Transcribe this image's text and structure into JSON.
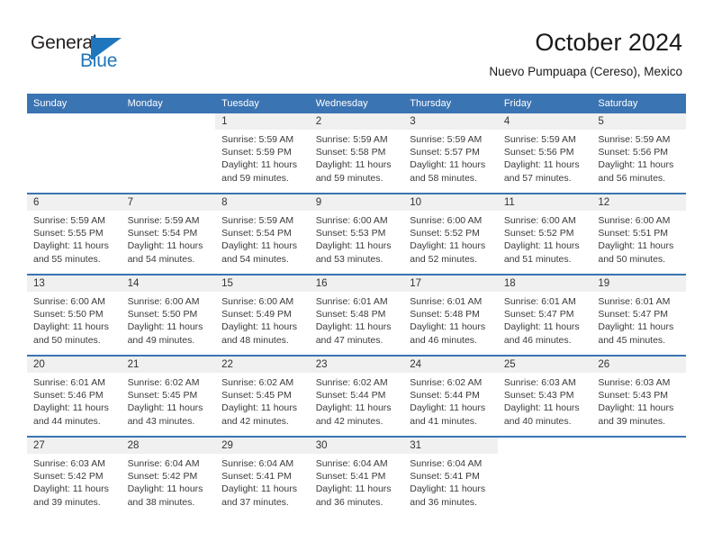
{
  "brand": {
    "name_part1": "General",
    "name_part2": "Blue",
    "logo_icon": "general-blue-triangle-logo",
    "accent_color": "#1f76bc"
  },
  "header": {
    "title": "October 2024",
    "location": "Nuevo Pumpuapa (Cereso), Mexico"
  },
  "theme": {
    "header_bg": "#3b74b3",
    "daynum_band_bg": "#f0f0f0",
    "separator_color": "#3b74b3",
    "text_color": "#3a3a3a"
  },
  "weekday_headers": [
    "Sunday",
    "Monday",
    "Tuesday",
    "Wednesday",
    "Thursday",
    "Friday",
    "Saturday"
  ],
  "weeks": [
    [
      {
        "day": "",
        "blank": true
      },
      {
        "day": "",
        "blank": true
      },
      {
        "day": "1",
        "sunrise": "Sunrise: 5:59 AM",
        "sunset": "Sunset: 5:59 PM",
        "daylight1": "Daylight: 11 hours",
        "daylight2": "and 59 minutes."
      },
      {
        "day": "2",
        "sunrise": "Sunrise: 5:59 AM",
        "sunset": "Sunset: 5:58 PM",
        "daylight1": "Daylight: 11 hours",
        "daylight2": "and 59 minutes."
      },
      {
        "day": "3",
        "sunrise": "Sunrise: 5:59 AM",
        "sunset": "Sunset: 5:57 PM",
        "daylight1": "Daylight: 11 hours",
        "daylight2": "and 58 minutes."
      },
      {
        "day": "4",
        "sunrise": "Sunrise: 5:59 AM",
        "sunset": "Sunset: 5:56 PM",
        "daylight1": "Daylight: 11 hours",
        "daylight2": "and 57 minutes."
      },
      {
        "day": "5",
        "sunrise": "Sunrise: 5:59 AM",
        "sunset": "Sunset: 5:56 PM",
        "daylight1": "Daylight: 11 hours",
        "daylight2": "and 56 minutes."
      }
    ],
    [
      {
        "day": "6",
        "sunrise": "Sunrise: 5:59 AM",
        "sunset": "Sunset: 5:55 PM",
        "daylight1": "Daylight: 11 hours",
        "daylight2": "and 55 minutes."
      },
      {
        "day": "7",
        "sunrise": "Sunrise: 5:59 AM",
        "sunset": "Sunset: 5:54 PM",
        "daylight1": "Daylight: 11 hours",
        "daylight2": "and 54 minutes."
      },
      {
        "day": "8",
        "sunrise": "Sunrise: 5:59 AM",
        "sunset": "Sunset: 5:54 PM",
        "daylight1": "Daylight: 11 hours",
        "daylight2": "and 54 minutes."
      },
      {
        "day": "9",
        "sunrise": "Sunrise: 6:00 AM",
        "sunset": "Sunset: 5:53 PM",
        "daylight1": "Daylight: 11 hours",
        "daylight2": "and 53 minutes."
      },
      {
        "day": "10",
        "sunrise": "Sunrise: 6:00 AM",
        "sunset": "Sunset: 5:52 PM",
        "daylight1": "Daylight: 11 hours",
        "daylight2": "and 52 minutes."
      },
      {
        "day": "11",
        "sunrise": "Sunrise: 6:00 AM",
        "sunset": "Sunset: 5:52 PM",
        "daylight1": "Daylight: 11 hours",
        "daylight2": "and 51 minutes."
      },
      {
        "day": "12",
        "sunrise": "Sunrise: 6:00 AM",
        "sunset": "Sunset: 5:51 PM",
        "daylight1": "Daylight: 11 hours",
        "daylight2": "and 50 minutes."
      }
    ],
    [
      {
        "day": "13",
        "sunrise": "Sunrise: 6:00 AM",
        "sunset": "Sunset: 5:50 PM",
        "daylight1": "Daylight: 11 hours",
        "daylight2": "and 50 minutes."
      },
      {
        "day": "14",
        "sunrise": "Sunrise: 6:00 AM",
        "sunset": "Sunset: 5:50 PM",
        "daylight1": "Daylight: 11 hours",
        "daylight2": "and 49 minutes."
      },
      {
        "day": "15",
        "sunrise": "Sunrise: 6:00 AM",
        "sunset": "Sunset: 5:49 PM",
        "daylight1": "Daylight: 11 hours",
        "daylight2": "and 48 minutes."
      },
      {
        "day": "16",
        "sunrise": "Sunrise: 6:01 AM",
        "sunset": "Sunset: 5:48 PM",
        "daylight1": "Daylight: 11 hours",
        "daylight2": "and 47 minutes."
      },
      {
        "day": "17",
        "sunrise": "Sunrise: 6:01 AM",
        "sunset": "Sunset: 5:48 PM",
        "daylight1": "Daylight: 11 hours",
        "daylight2": "and 46 minutes."
      },
      {
        "day": "18",
        "sunrise": "Sunrise: 6:01 AM",
        "sunset": "Sunset: 5:47 PM",
        "daylight1": "Daylight: 11 hours",
        "daylight2": "and 46 minutes."
      },
      {
        "day": "19",
        "sunrise": "Sunrise: 6:01 AM",
        "sunset": "Sunset: 5:47 PM",
        "daylight1": "Daylight: 11 hours",
        "daylight2": "and 45 minutes."
      }
    ],
    [
      {
        "day": "20",
        "sunrise": "Sunrise: 6:01 AM",
        "sunset": "Sunset: 5:46 PM",
        "daylight1": "Daylight: 11 hours",
        "daylight2": "and 44 minutes."
      },
      {
        "day": "21",
        "sunrise": "Sunrise: 6:02 AM",
        "sunset": "Sunset: 5:45 PM",
        "daylight1": "Daylight: 11 hours",
        "daylight2": "and 43 minutes."
      },
      {
        "day": "22",
        "sunrise": "Sunrise: 6:02 AM",
        "sunset": "Sunset: 5:45 PM",
        "daylight1": "Daylight: 11 hours",
        "daylight2": "and 42 minutes."
      },
      {
        "day": "23",
        "sunrise": "Sunrise: 6:02 AM",
        "sunset": "Sunset: 5:44 PM",
        "daylight1": "Daylight: 11 hours",
        "daylight2": "and 42 minutes."
      },
      {
        "day": "24",
        "sunrise": "Sunrise: 6:02 AM",
        "sunset": "Sunset: 5:44 PM",
        "daylight1": "Daylight: 11 hours",
        "daylight2": "and 41 minutes."
      },
      {
        "day": "25",
        "sunrise": "Sunrise: 6:03 AM",
        "sunset": "Sunset: 5:43 PM",
        "daylight1": "Daylight: 11 hours",
        "daylight2": "and 40 minutes."
      },
      {
        "day": "26",
        "sunrise": "Sunrise: 6:03 AM",
        "sunset": "Sunset: 5:43 PM",
        "daylight1": "Daylight: 11 hours",
        "daylight2": "and 39 minutes."
      }
    ],
    [
      {
        "day": "27",
        "sunrise": "Sunrise: 6:03 AM",
        "sunset": "Sunset: 5:42 PM",
        "daylight1": "Daylight: 11 hours",
        "daylight2": "and 39 minutes."
      },
      {
        "day": "28",
        "sunrise": "Sunrise: 6:04 AM",
        "sunset": "Sunset: 5:42 PM",
        "daylight1": "Daylight: 11 hours",
        "daylight2": "and 38 minutes."
      },
      {
        "day": "29",
        "sunrise": "Sunrise: 6:04 AM",
        "sunset": "Sunset: 5:41 PM",
        "daylight1": "Daylight: 11 hours",
        "daylight2": "and 37 minutes."
      },
      {
        "day": "30",
        "sunrise": "Sunrise: 6:04 AM",
        "sunset": "Sunset: 5:41 PM",
        "daylight1": "Daylight: 11 hours",
        "daylight2": "and 36 minutes."
      },
      {
        "day": "31",
        "sunrise": "Sunrise: 6:04 AM",
        "sunset": "Sunset: 5:41 PM",
        "daylight1": "Daylight: 11 hours",
        "daylight2": "and 36 minutes."
      },
      {
        "day": "",
        "blank": true
      },
      {
        "day": "",
        "blank": true
      }
    ]
  ]
}
